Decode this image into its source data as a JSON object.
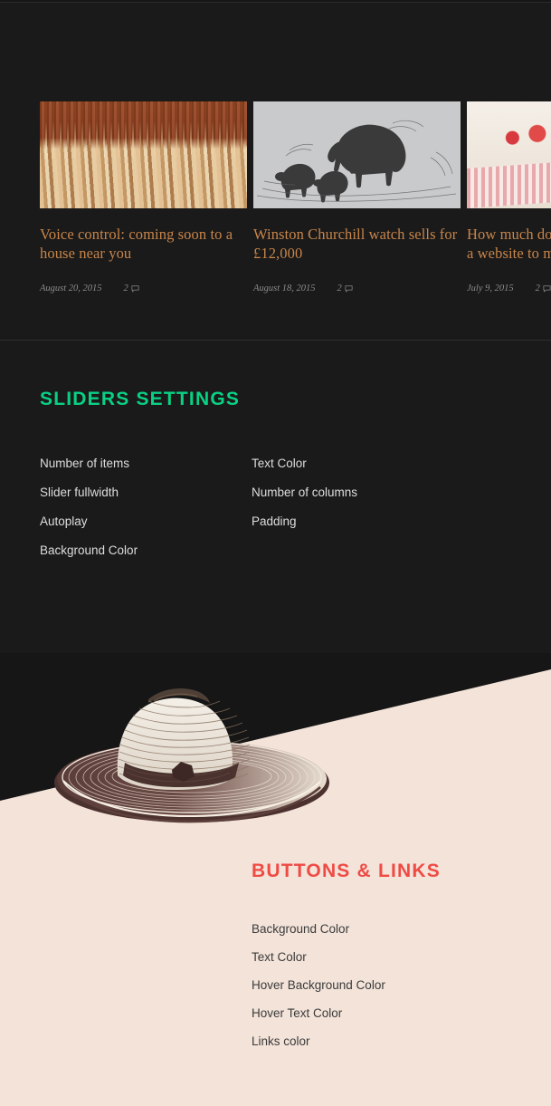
{
  "posts": {
    "items": [
      {
        "title": "Voice control: coming soon to a house near you",
        "date": "August 20, 2015",
        "comments": "2",
        "image_name": "wheat-on-wood-photo"
      },
      {
        "title": "Winston Churchill watch sells for £12,000",
        "date": "August 18, 2015",
        "comments": "2",
        "image_name": "bear-engraving-illustration"
      },
      {
        "title": "How much does it cost to convert a website to mobile app",
        "date": "July 9, 2015",
        "comments": "2",
        "image_name": "breakfast-table-photo"
      }
    ]
  },
  "sliders_settings": {
    "heading": "SLIDERS SETTINGS",
    "heading_color": "#09d184",
    "left_items": [
      "Number of items",
      "Slider fullwidth",
      "Autoplay",
      "Background Color"
    ],
    "right_items": [
      "Text Color",
      "Number of columns",
      "Padding"
    ]
  },
  "buttons_links": {
    "heading": "BUTTONS & LINKS",
    "heading_color": "#ef4b45",
    "items": [
      "Background Color",
      "Text Color",
      "Hover Background Color",
      "Hover Text Color",
      "Links color"
    ]
  },
  "theme": {
    "dark_background": "#1a1a1a",
    "beige_background": "#f3e3d9",
    "post_title_color": "#c8854a",
    "meta_color": "#8c8c8c",
    "settings_text_color": "#dddddd",
    "buttons_text_color": "#3b3b3b"
  },
  "illustration": {
    "hat_name": "straw-hat-engraving"
  }
}
